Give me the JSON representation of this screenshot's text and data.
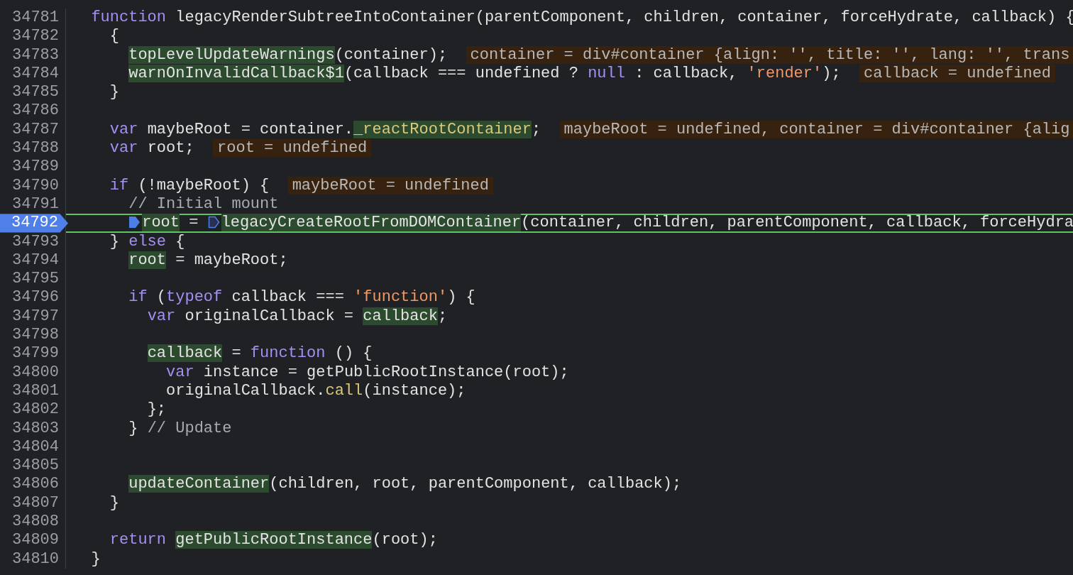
{
  "editor": {
    "lines": [
      {
        "number": "34781",
        "tokens": [
          {
            "kind": "keyword",
            "text": "  function"
          },
          {
            "kind": "plain",
            "text": " legacyRenderSubtreeIntoContainer(parentComponent, children, container, forceHydrate, callback) {"
          }
        ]
      },
      {
        "number": "34782",
        "tokens": [
          {
            "kind": "plain",
            "text": "    {"
          }
        ]
      },
      {
        "number": "34783",
        "tokens": [
          {
            "kind": "call",
            "text": "      topLevelUpdateWarnings"
          },
          {
            "kind": "plain",
            "text": "(container);  "
          },
          {
            "kind": "value",
            "text": "container = div#container {align: '', title: '', lang: '', trans"
          }
        ]
      },
      {
        "number": "34784",
        "tokens": [
          {
            "kind": "call",
            "text": "      warnOnInvalidCallback$1"
          },
          {
            "kind": "plain",
            "text": "(callback === undefined ? "
          },
          {
            "kind": "keyword",
            "text": "null"
          },
          {
            "kind": "plain",
            "text": " : callback, "
          },
          {
            "kind": "string",
            "text": "'render'"
          },
          {
            "kind": "plain",
            "text": ");  "
          },
          {
            "kind": "value",
            "text": "callback = undefined"
          }
        ]
      },
      {
        "number": "34785",
        "tokens": [
          {
            "kind": "plain",
            "text": "    }"
          }
        ]
      },
      {
        "number": "34786"
      },
      {
        "number": "34787",
        "tokens": [
          {
            "kind": "keyword",
            "text": "    var"
          },
          {
            "kind": "plain",
            "text": " maybeRoot = container."
          },
          {
            "kind": "property",
            "text": "_reactRootContainer"
          },
          {
            "kind": "plain",
            "text": ";  "
          },
          {
            "kind": "value",
            "text": "maybeRoot = undefined, container = div#container {alig"
          }
        ]
      },
      {
        "number": "34788",
        "tokens": [
          {
            "kind": "keyword",
            "text": "    var"
          },
          {
            "kind": "plain",
            "text": " root;  "
          },
          {
            "kind": "value",
            "text": "root = undefined"
          }
        ]
      },
      {
        "number": "34789"
      },
      {
        "number": "34790",
        "tokens": [
          {
            "kind": "keyword",
            "text": "    if"
          },
          {
            "kind": "plain",
            "text": " (!maybeRoot) {  "
          },
          {
            "kind": "value",
            "text": "maybeRoot = undefined"
          }
        ]
      },
      {
        "number": "34791",
        "tokens": [
          {
            "kind": "comment",
            "text": "      // Initial mount"
          }
        ]
      },
      {
        "number": "34792",
        "breakpoint": true,
        "paused": true,
        "tokens": [
          {
            "kind": "call",
            "execution_point": true,
            "text": "      root"
          },
          {
            "kind": "plain",
            "text": " = "
          },
          {
            "kind": "call",
            "step_target": true,
            "text": "legacyCreateRootFromDOMContainer"
          },
          {
            "kind": "plain",
            "text": "(container, children, parentComponent, callback, forceHydra"
          }
        ]
      },
      {
        "number": "34793",
        "tokens": [
          {
            "kind": "plain",
            "text": "    } "
          },
          {
            "kind": "keyword",
            "text": "else"
          },
          {
            "kind": "plain",
            "text": " {"
          }
        ]
      },
      {
        "number": "34794",
        "tokens": [
          {
            "kind": "call",
            "text": "      root"
          },
          {
            "kind": "plain",
            "text": " = maybeRoot;"
          }
        ]
      },
      {
        "number": "34795"
      },
      {
        "number": "34796",
        "tokens": [
          {
            "kind": "keyword",
            "text": "      if"
          },
          {
            "kind": "plain",
            "text": " ("
          },
          {
            "kind": "keyword",
            "text": "typeof"
          },
          {
            "kind": "plain",
            "text": " callback === "
          },
          {
            "kind": "string",
            "text": "'function'"
          },
          {
            "kind": "plain",
            "text": ") {"
          }
        ]
      },
      {
        "number": "34797",
        "tokens": [
          {
            "kind": "keyword",
            "text": "        var"
          },
          {
            "kind": "plain",
            "text": " originalCallback = "
          },
          {
            "kind": "call",
            "text": "callback"
          },
          {
            "kind": "plain",
            "text": ";"
          }
        ]
      },
      {
        "number": "34798"
      },
      {
        "number": "34799",
        "tokens": [
          {
            "kind": "call",
            "text": "        callback"
          },
          {
            "kind": "plain",
            "text": " = "
          },
          {
            "kind": "keyword",
            "text": "function"
          },
          {
            "kind": "plain",
            "text": " () {"
          }
        ]
      },
      {
        "number": "34800",
        "tokens": [
          {
            "kind": "keyword",
            "text": "          var"
          },
          {
            "kind": "plain",
            "text": " instance = getPublicRootInstance(root);"
          }
        ]
      },
      {
        "number": "34801",
        "tokens": [
          {
            "kind": "plain",
            "text": "          originalCallback."
          },
          {
            "kind": "method",
            "text": "call"
          },
          {
            "kind": "plain",
            "text": "(instance);"
          }
        ]
      },
      {
        "number": "34802",
        "tokens": [
          {
            "kind": "plain",
            "text": "        };"
          }
        ]
      },
      {
        "number": "34803",
        "tokens": [
          {
            "kind": "plain",
            "text": "      } "
          },
          {
            "kind": "comment",
            "text": "// Update"
          }
        ]
      },
      {
        "number": "34804"
      },
      {
        "number": "34805"
      },
      {
        "number": "34806",
        "tokens": [
          {
            "kind": "call",
            "text": "      updateContainer"
          },
          {
            "kind": "plain",
            "text": "(children, root, parentComponent, callback);"
          }
        ]
      },
      {
        "number": "34807",
        "tokens": [
          {
            "kind": "plain",
            "text": "    }"
          }
        ]
      },
      {
        "number": "34808"
      },
      {
        "number": "34809",
        "tokens": [
          {
            "kind": "keyword",
            "text": "    return"
          },
          {
            "kind": "call",
            "text": " getPublicRootInstance"
          },
          {
            "kind": "plain",
            "text": "(root);"
          }
        ]
      },
      {
        "number": "34810",
        "tokens": [
          {
            "kind": "plain",
            "text": "  }"
          }
        ]
      }
    ]
  }
}
